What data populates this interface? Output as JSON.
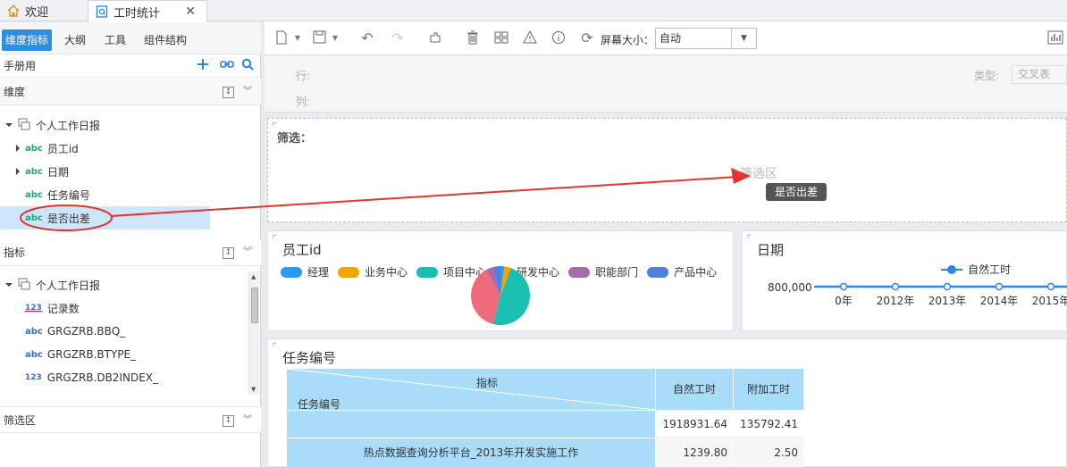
{
  "tabs": [
    {
      "label": "欢迎"
    },
    {
      "label": "工时统计"
    }
  ],
  "left_panel": {
    "tabs": [
      "维度指标",
      "大纲",
      "工具",
      "组件结构"
    ],
    "package_label": "手册用",
    "dimension": {
      "title": "维度",
      "group": "个人工作日报",
      "fields": [
        "员工id",
        "日期",
        "任务编号",
        "是否出差"
      ]
    },
    "metric": {
      "title": "指标",
      "group": "个人工作日报",
      "fields": [
        "记录数",
        "GRGZRB.BBQ_",
        "GRGZRB.BTYPE_",
        "GRGZRB.DB2INDEX_"
      ]
    },
    "filter_area": {
      "title": "筛选区"
    }
  },
  "toolbar": {
    "screen_size_label": "屏幕大小：",
    "screen_size_value": "自动"
  },
  "design": {
    "row_label": "行:",
    "col_label": "列:",
    "type_label": "类型:",
    "type_value": "交叉表"
  },
  "filter_panel": {
    "title": "筛选：",
    "placeholder": "筛选区",
    "drag_tooltip": "是否出差"
  },
  "chart_employee": {
    "title": "员工id",
    "chart_data": {
      "type": "pie",
      "title": "员工id",
      "categories": [
        "经理",
        "业务中心",
        "项目中心",
        "研发中心",
        "职能部门",
        "产品中心"
      ],
      "values": [
        2,
        4,
        48,
        38,
        4,
        4
      ],
      "colors": [
        "#2b9af3",
        "#f5a300",
        "#19bfb0",
        "#ef6a7a",
        "#a869ad",
        "#4f7fe0"
      ],
      "legend": "top"
    }
  },
  "chart_date": {
    "title": "日期",
    "chart_data": {
      "type": "line",
      "title": "日期",
      "x": [
        "0年",
        "2012年",
        "2013年",
        "2014年",
        "2015年"
      ],
      "series": [
        {
          "name": "自然工时",
          "values": [
            800000,
            800000,
            800000,
            800000,
            800000
          ]
        }
      ],
      "y_ticks": [
        "800,000"
      ],
      "color": "#2f86e0",
      "legend": "top"
    }
  },
  "task_table": {
    "title": "任务编号",
    "header_metric": "指标",
    "header_dim": "任务编号",
    "columns": [
      "自然工时",
      "附加工时"
    ],
    "rows": [
      {
        "label": "",
        "values": [
          "1918931.64",
          "135792.41"
        ]
      },
      {
        "label": "热点数据查询分析平台_2013年开发实施工作",
        "values": [
          "1239.80",
          "2.50"
        ]
      }
    ]
  }
}
